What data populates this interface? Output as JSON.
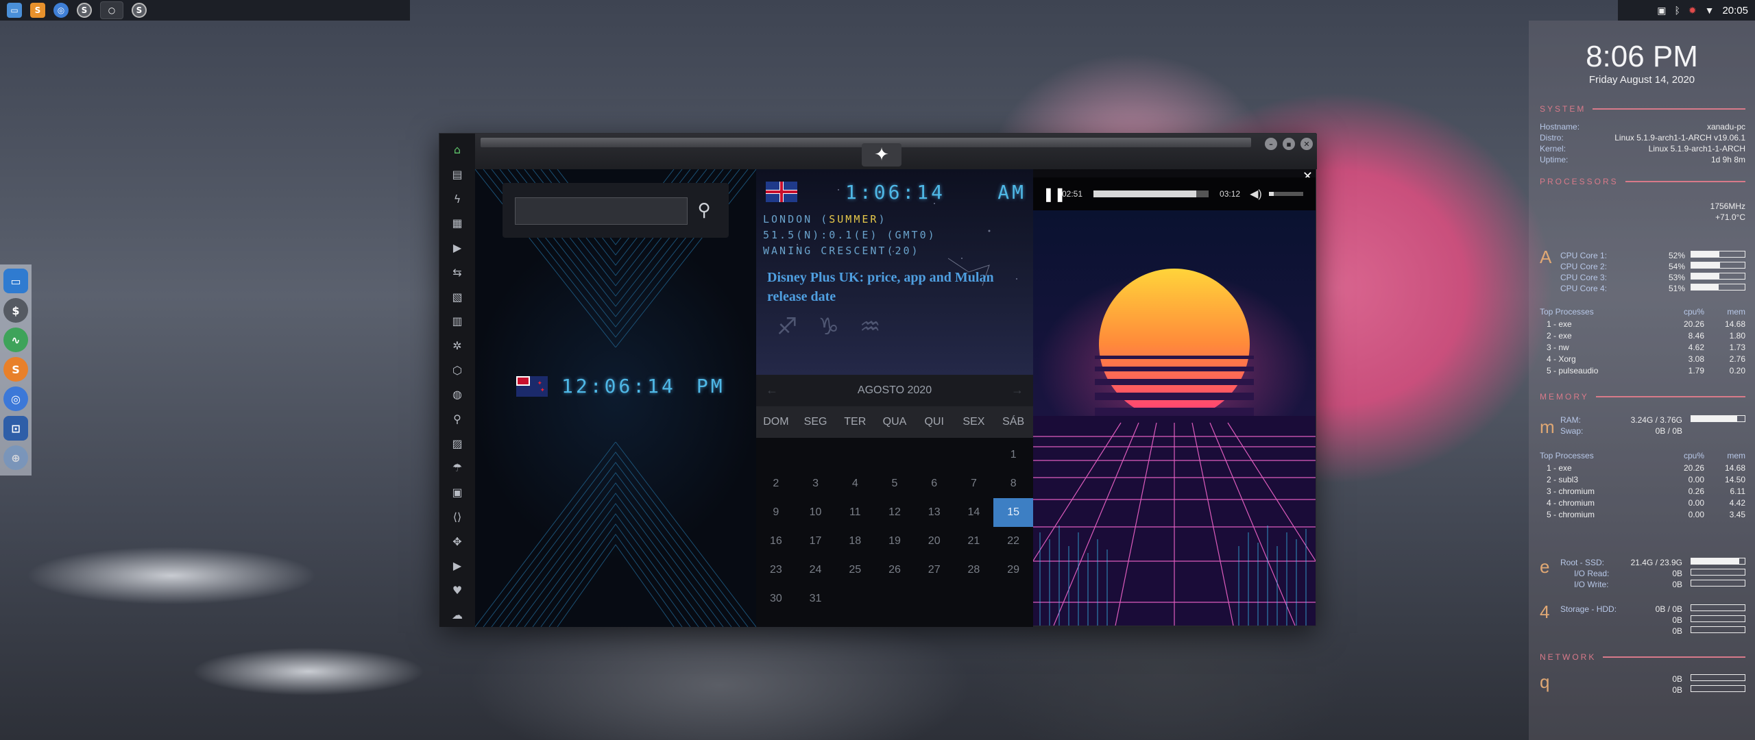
{
  "panel": {
    "clock": "20:05",
    "launchers": [
      "files-icon",
      "sublime-icon",
      "chromium-icon",
      "hexchat-icon",
      "terminal-icon",
      "screenshot-icon"
    ]
  },
  "dock": {
    "items": [
      "file-manager-icon",
      "money-icon",
      "activity-icon",
      "sublime-icon",
      "chromium-icon",
      "screenshot-icon",
      "network-icon"
    ]
  },
  "app": {
    "search": {
      "value": "",
      "placeholder": ""
    },
    "nz_clock": {
      "time": "12:06:14",
      "ampm": "PM"
    },
    "uk_clock": {
      "time": "1:06:14",
      "ampm": "AM"
    },
    "info_lines": {
      "line1_prefix": "LONDON (",
      "line1_hl": "SUMMER",
      "line1_suffix": ")",
      "line2": "51.5(N):0.1(E) (GMT0)",
      "line3": "WANING CRESCENT(20)"
    },
    "headline": "Disney Plus UK: price, app and Mulan release date",
    "calendar": {
      "month": "AGOSTO 2020",
      "prev": "←",
      "next": "→",
      "dow": [
        "DOM",
        "SEG",
        "TER",
        "QUA",
        "QUI",
        "SEX",
        "SÁB"
      ],
      "weeks": [
        [
          "",
          "",
          "",
          "",
          "",
          "",
          "1"
        ],
        [
          "2",
          "3",
          "4",
          "5",
          "6",
          "7",
          "8"
        ],
        [
          "9",
          "10",
          "11",
          "12",
          "13",
          "14",
          "15"
        ],
        [
          "16",
          "17",
          "18",
          "19",
          "20",
          "21",
          "22"
        ],
        [
          "23",
          "24",
          "25",
          "26",
          "27",
          "28",
          "29"
        ],
        [
          "30",
          "31",
          "",
          "",
          "",
          "",
          ""
        ]
      ],
      "today": "15"
    },
    "player": {
      "elapsed": "02:51",
      "duration": "03:12",
      "progress": 0.89,
      "volume": 0.15,
      "close": "✕"
    }
  },
  "conky": {
    "time": "8:06 PM",
    "date": "Friday August 14, 2020",
    "system": {
      "title": "SYSTEM",
      "rows": [
        {
          "k": "Hostname:",
          "v": "xanadu-pc"
        },
        {
          "k": "Distro:",
          "v": "Linux 5.1.9-arch1-1-ARCH v19.06.1"
        },
        {
          "k": "Kernel:",
          "v": "Linux 5.1.9-arch1-1-ARCH"
        },
        {
          "k": "Uptime:",
          "v": "1d 9h 8m"
        }
      ]
    },
    "processors": {
      "title": "PROCESSORS",
      "freq": "1756MHz",
      "temp": "+71.0°C",
      "icon": "A",
      "cores": [
        {
          "label": "CPU Core 1:",
          "val": "52%",
          "pct": 0.52
        },
        {
          "label": "CPU Core 2:",
          "val": "54%",
          "pct": 0.54
        },
        {
          "label": "CPU Core 3:",
          "val": "53%",
          "pct": 0.53
        },
        {
          "label": "CPU Core 4:",
          "val": "51%",
          "pct": 0.51
        }
      ],
      "hdr": {
        "n": "Top Processes",
        "c": "cpu%",
        "m": "mem"
      },
      "procs": [
        {
          "n": "1 - exe",
          "c": "20.26",
          "m": "14.68"
        },
        {
          "n": "2 - exe",
          "c": "8.46",
          "m": "1.80"
        },
        {
          "n": "3 - nw",
          "c": "4.62",
          "m": "1.73"
        },
        {
          "n": "4 - Xorg",
          "c": "3.08",
          "m": "2.76"
        },
        {
          "n": "5 - pulseaudio",
          "c": "1.79",
          "m": "0.20"
        }
      ]
    },
    "memory": {
      "title": "MEMORY",
      "icon": "m",
      "ram": {
        "k": "RAM:",
        "v": "3.24G / 3.76G",
        "pct": 0.86
      },
      "swap": {
        "k": "Swap:",
        "v": "0B / 0B"
      },
      "hdr": {
        "n": "Top Processes",
        "c": "cpu%",
        "m": "mem"
      },
      "procs": [
        {
          "n": "1 - exe",
          "c": "20.26",
          "m": "14.68"
        },
        {
          "n": "2 - subl3",
          "c": "0.00",
          "m": "14.50"
        },
        {
          "n": "3 - chromium",
          "c": "0.26",
          "m": "6.11"
        },
        {
          "n": "4 - chromium",
          "c": "0.00",
          "m": "4.42"
        },
        {
          "n": "5 - chromium",
          "c": "0.00",
          "m": "3.45"
        }
      ]
    },
    "storage": {
      "icon": "e",
      "icon2": "4",
      "root": {
        "k": "Root - SSD:",
        "v": "21.4G / 23.9G",
        "pct": 0.9
      },
      "io_read": {
        "k": "I/O Read:",
        "v": "0B"
      },
      "io_write": {
        "k": "I/O Write:",
        "v": "0B"
      },
      "hdd": {
        "k": "Storage - HDD:",
        "v": "0B / 0B"
      },
      "hdd_r": {
        "v": "0B"
      },
      "hdd_w": {
        "v": "0B"
      }
    },
    "network": {
      "title": "NETWORK",
      "icon": "q",
      "down": {
        "v": "0B"
      },
      "up": {
        "v": "0B"
      }
    }
  }
}
